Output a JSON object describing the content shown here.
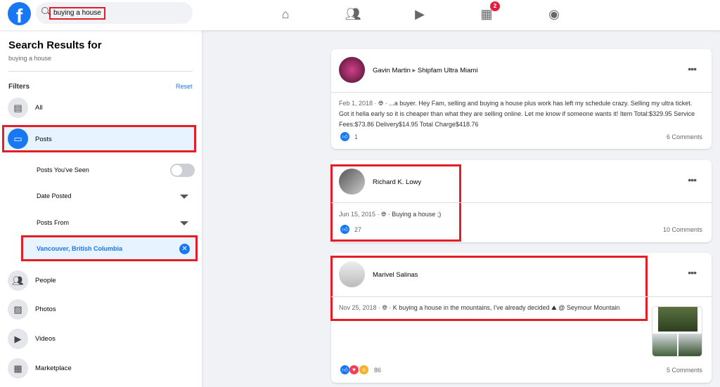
{
  "header": {
    "search_value": "buying a house",
    "nav": [
      {
        "icon": "home-icon"
      },
      {
        "icon": "friends-icon"
      },
      {
        "icon": "watch-icon"
      },
      {
        "icon": "marketplace-icon",
        "badge": "2"
      },
      {
        "icon": "groups-icon"
      }
    ]
  },
  "sidebar": {
    "title": "Search Results for",
    "query": "buying a house",
    "filters_label": "Filters",
    "reset_label": "Reset",
    "items": [
      {
        "label": "All"
      },
      {
        "label": "Posts"
      },
      {
        "label": "People"
      },
      {
        "label": "Photos"
      },
      {
        "label": "Videos"
      },
      {
        "label": "Marketplace"
      }
    ],
    "posts_filters": {
      "seen_label": "Posts You've Seen",
      "seen_on": false,
      "date_label": "Date Posted",
      "from_label": "Posts From",
      "location": "Vancouver, British Columbia"
    }
  },
  "posts": [
    {
      "author": "Gavin Martin",
      "group": "Shipfam Ultra Miami",
      "date": "Feb 1, 2018 ·",
      "text": " · ...a buyer. Hey Fam, selling and buying a house plus work has left my schedule crazy. Selling my ultra ticket. Got it hella early so it is cheaper than what they are selling online. Let me know if someone wants it! Item Total:$329.95 Service Fees:$73.86 Delivery$14.95 Total Charge$418.76",
      "reactions": "1",
      "comments": "6 Comments"
    },
    {
      "author": "Richard K. Lowy",
      "date": "Jun 15, 2015 ·",
      "text": " · Buying a house ;)",
      "reactions": "27",
      "comments": "10 Comments"
    },
    {
      "author": "Marivel Salinas",
      "date": "Nov 25, 2018 ·",
      "text": " · K buying a house in the mountains, I've already decided ⛰ @ Seymour Mountain",
      "reactions": "86",
      "comments": "5 Comments"
    }
  ],
  "colors": {
    "brand": "#1877f2",
    "highlight": "#e41e26"
  }
}
